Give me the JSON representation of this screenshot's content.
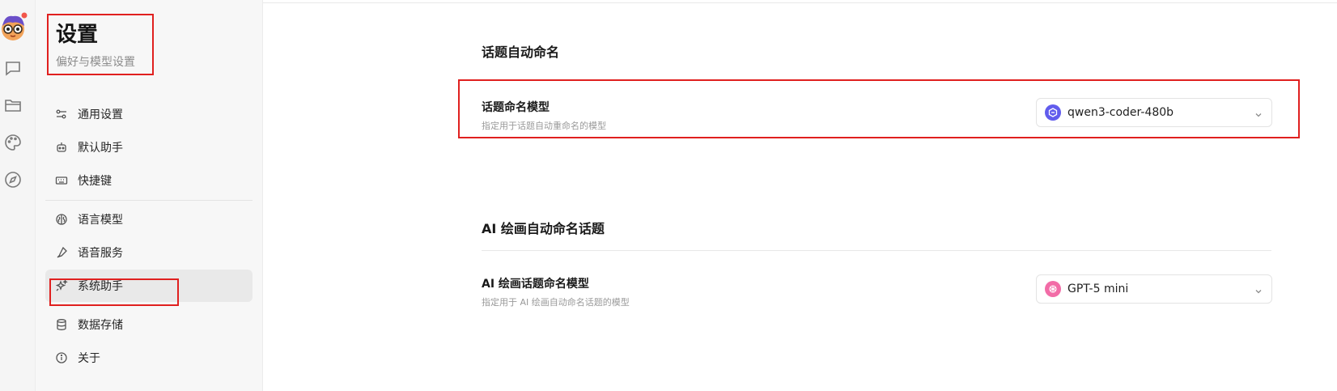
{
  "rail": {
    "icons": [
      "avatar",
      "chat-icon",
      "folder-icon",
      "palette-icon",
      "compass-icon"
    ]
  },
  "sidebar": {
    "title": "设置",
    "subtitle": "偏好与模型设置",
    "items": [
      {
        "label": "通用设置",
        "icon": "sliders-icon"
      },
      {
        "label": "默认助手",
        "icon": "robot-icon"
      },
      {
        "label": "快捷键",
        "icon": "keyboard-icon"
      },
      {
        "label": "语言模型",
        "icon": "brain-icon"
      },
      {
        "label": "语音服务",
        "icon": "microphone-icon"
      },
      {
        "label": "系统助手",
        "icon": "sparkles-icon",
        "active": true
      },
      {
        "label": "数据存储",
        "icon": "database-icon"
      },
      {
        "label": "关于",
        "icon": "info-icon"
      }
    ]
  },
  "main": {
    "topic_section": {
      "title": "话题自动命名",
      "label": "话题命名模型",
      "description": "指定用于话题自动重命名的模型",
      "model": "qwen3-coder-480b"
    },
    "ai_paint_section": {
      "title": "AI 绘画自动命名话题",
      "label": "AI 绘画话题命名模型",
      "description": "指定用于 AI 绘画自动命名话题的模型",
      "model": "GPT-5 mini"
    }
  },
  "colors": {
    "highlight": "#e0201f",
    "qwen_logo": "#615ced",
    "gpt_logo": "#f26ca7",
    "active_nav": "#e9e9e9"
  }
}
